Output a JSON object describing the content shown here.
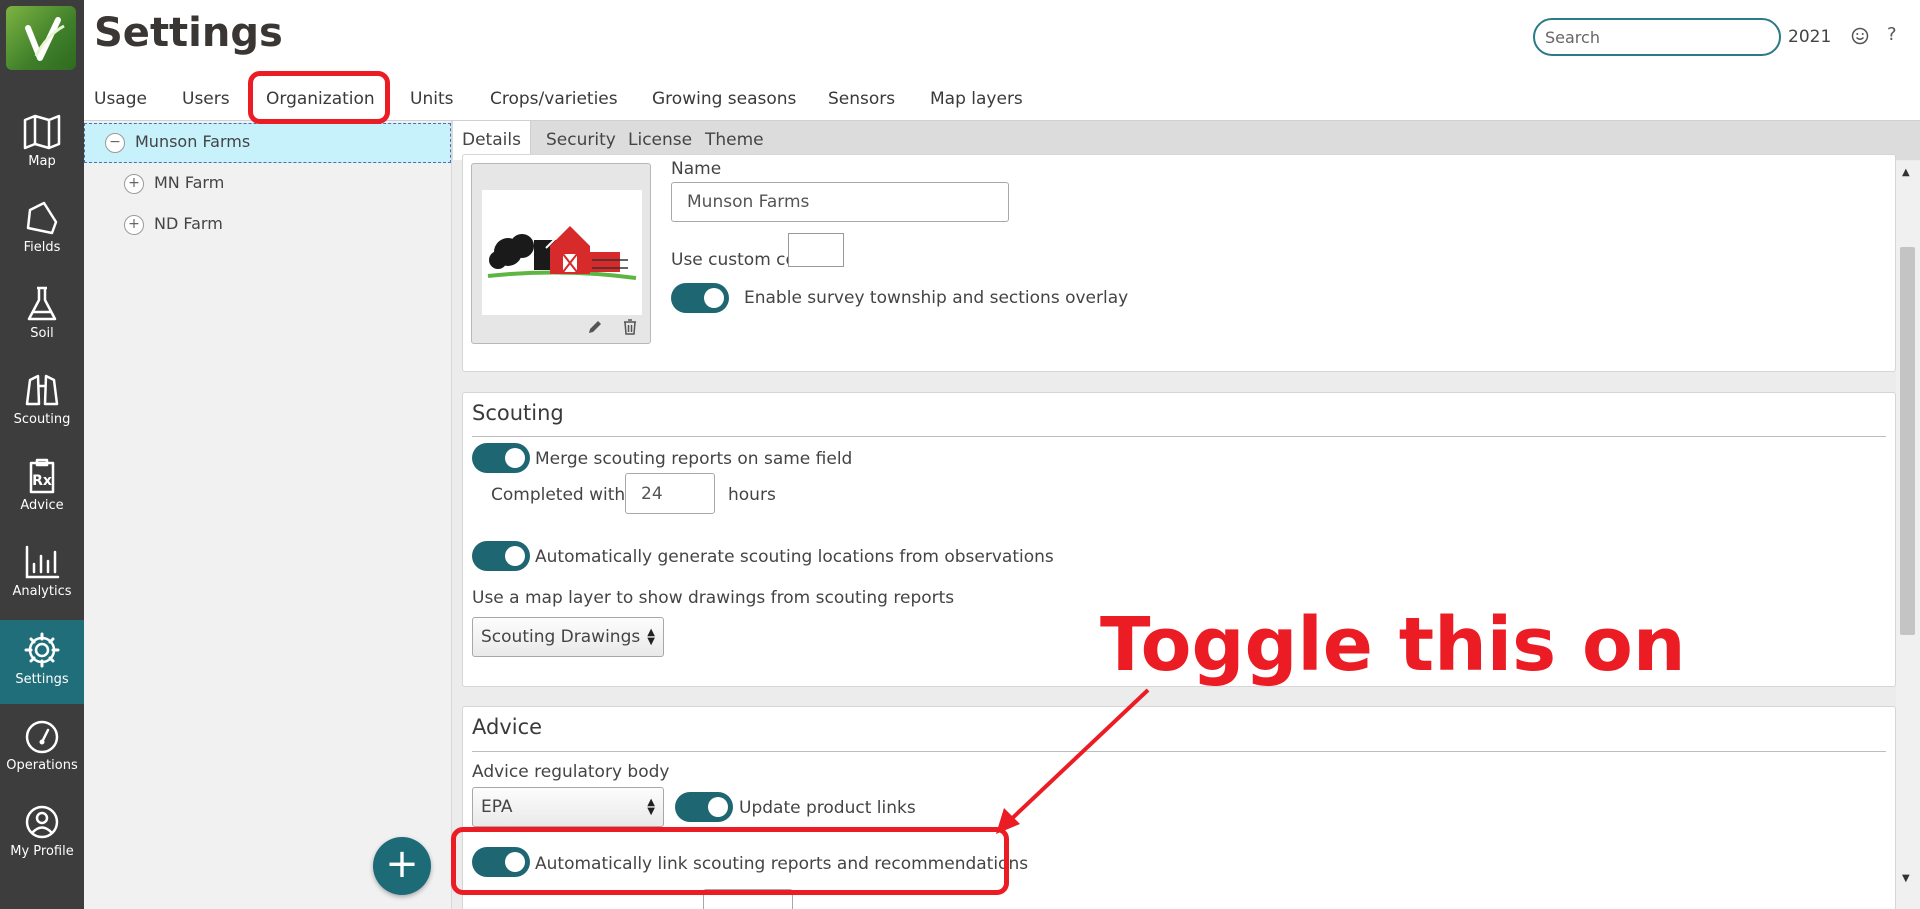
{
  "header": {
    "title": "Settings",
    "search_placeholder": "Search",
    "year": "2021",
    "help_symbol": "?"
  },
  "sidebar": {
    "items": [
      {
        "label": "Map",
        "icon": "map-icon"
      },
      {
        "label": "Fields",
        "icon": "fields-icon"
      },
      {
        "label": "Soil",
        "icon": "flask-icon"
      },
      {
        "label": "Scouting",
        "icon": "binoculars-icon"
      },
      {
        "label": "Advice",
        "icon": "prescription-icon"
      },
      {
        "label": "Analytics",
        "icon": "bar-chart-icon"
      },
      {
        "label": "Settings",
        "icon": "gear-icon",
        "active": true
      },
      {
        "label": "Operations",
        "icon": "gauge-icon"
      },
      {
        "label": "My Profile",
        "icon": "user-icon"
      }
    ]
  },
  "tabs": [
    "Usage",
    "Users",
    "Organization",
    "Units",
    "Crops/varieties",
    "Growing seasons",
    "Sensors",
    "Map layers"
  ],
  "active_tab": "Organization",
  "tree": {
    "root": {
      "label": "Munson Farms",
      "sign": "−"
    },
    "children": [
      {
        "label": "MN Farm",
        "sign": "+"
      },
      {
        "label": "ND Farm",
        "sign": "+"
      }
    ]
  },
  "subtabs": [
    "Details",
    "Security",
    "License",
    "Theme"
  ],
  "details": {
    "name_label": "Name",
    "name_value": "Munson Farms",
    "custom_color_label": "Use custom color",
    "survey_toggle_label": "Enable survey township and sections overlay"
  },
  "scouting": {
    "heading": "Scouting",
    "merge_label": "Merge scouting reports on same field",
    "completed_within_label": "Completed within",
    "completed_within_value": "24",
    "hours_label": "hours",
    "auto_generate_label": "Automatically generate scouting locations from observations",
    "map_layer_label": "Use a map layer to show drawings from scouting reports",
    "map_layer_value": "Scouting Drawings"
  },
  "advice": {
    "heading": "Advice",
    "regulatory_label": "Advice regulatory body",
    "regulatory_value": "EPA",
    "update_links_label": "Update product links",
    "auto_link_label": "Automatically link scouting reports and recommendations"
  },
  "annotation": {
    "text": "Toggle this on",
    "color": "#ec1c24"
  },
  "colors": {
    "sidebar_bg": "#3d3d3d",
    "active_teal": "#1f6e7a",
    "toggle_on": "#1e6772",
    "tree_selected": "#c7f2fb"
  }
}
